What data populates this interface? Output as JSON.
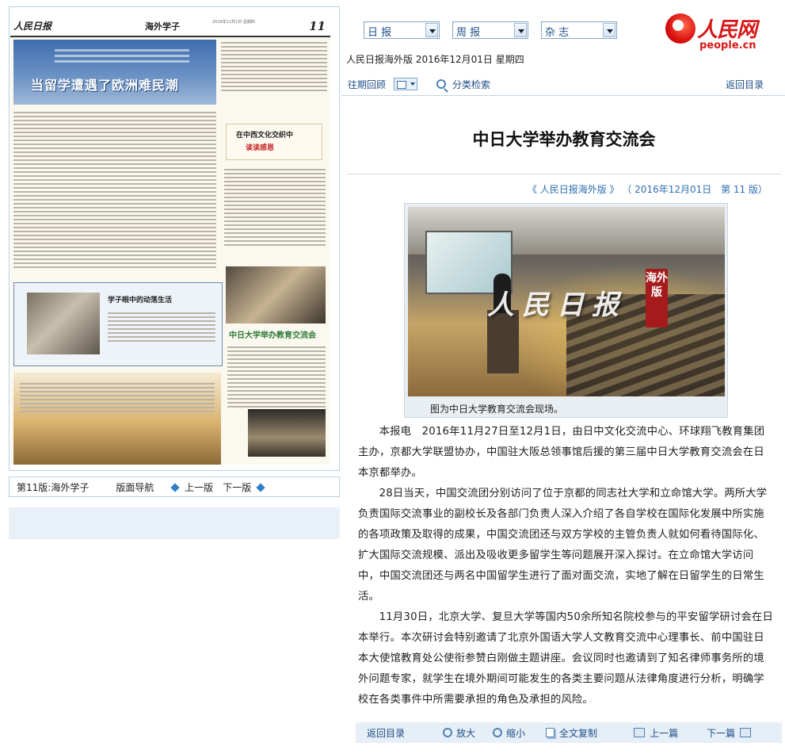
{
  "newspaper": {
    "masthead": "人民日报",
    "section": "海外学子",
    "page_number": "11",
    "date_small": "2016年12月1日 星期四",
    "headline_main": "当留学遭遇了欧洲难民潮",
    "headline_culture_black": "在中西文化交织中",
    "headline_culture_red": "读读感恩",
    "headline_study": "学子眼中的动荡生活",
    "headline_exchange": "中日大学举办教育交流会"
  },
  "page_toolbar": {
    "page_label": "第11版:海外学子",
    "nav_label": "版面导航",
    "prev_page": "上一版",
    "next_page": "下一版"
  },
  "selects": {
    "daily": "日 报",
    "weekly": "周 报",
    "magazine": "杂 志"
  },
  "logo": {
    "text": "人民网",
    "url": "people.cn"
  },
  "edition_line": "人民日报海外版 2016年12月01日 星期四",
  "top_nav": {
    "archive": "往期回顾",
    "category_search": "分类检索",
    "return_dir": "返回目录"
  },
  "article": {
    "title": "中日大学举办教育交流会",
    "source_prefix": "《 人民日报海外版 》",
    "source_date": "（ 2016年12月01日",
    "source_page": "第 11 版）",
    "photo_watermark": "人民日报",
    "photo_watermark_sub": "海外版",
    "photo_caption": "图为中日大学教育交流会现场。",
    "paragraphs": [
      "本报电　2016年11月27日至12月1日，由日中文化交流中心、环球翔飞教育集团主办，京都大学联盟协办，中国驻大阪总领事馆后援的第三届中日大学教育交流会在日本京都举办。",
      "28日当天，中国交流团分别访问了位于京都的同志社大学和立命馆大学。两所大学负责国际交流事业的副校长及各部门负责人深入介绍了各自学校在国际化发展中所实施的各项政策及取得的成果，中国交流团还与双方学校的主管负责人就如何看待国际化、扩大国际交流规模、派出及吸收更多留学生等问题展开深入探讨。在立命馆大学访问中，中国交流团还与两名中国留学生进行了面对面交流，实地了解在日留学生的日常生活。",
      "11月30日，北京大学、复旦大学等国内50余所知名院校参与的平安留学研讨会在日本举行。本次研讨会特别邀请了北京外国语大学人文教育交流中心理事长、前中国驻日本大使馆教育处公使衔参赞白刚做主题讲座。会议同时也邀请到了知名律师事务所的境外问题专家，就学生在境外期间可能发生的各类主要问题从法律角度进行分析，明确学校在各类事件中所需要承担的角色及承担的风险。"
    ]
  },
  "bottom_toolbar": {
    "return_dir": "返回目录",
    "zoom_in": "放大",
    "zoom_out": "缩小",
    "copy_all": "全文复制",
    "prev_article": "上一篇",
    "next_article": "下一篇"
  }
}
